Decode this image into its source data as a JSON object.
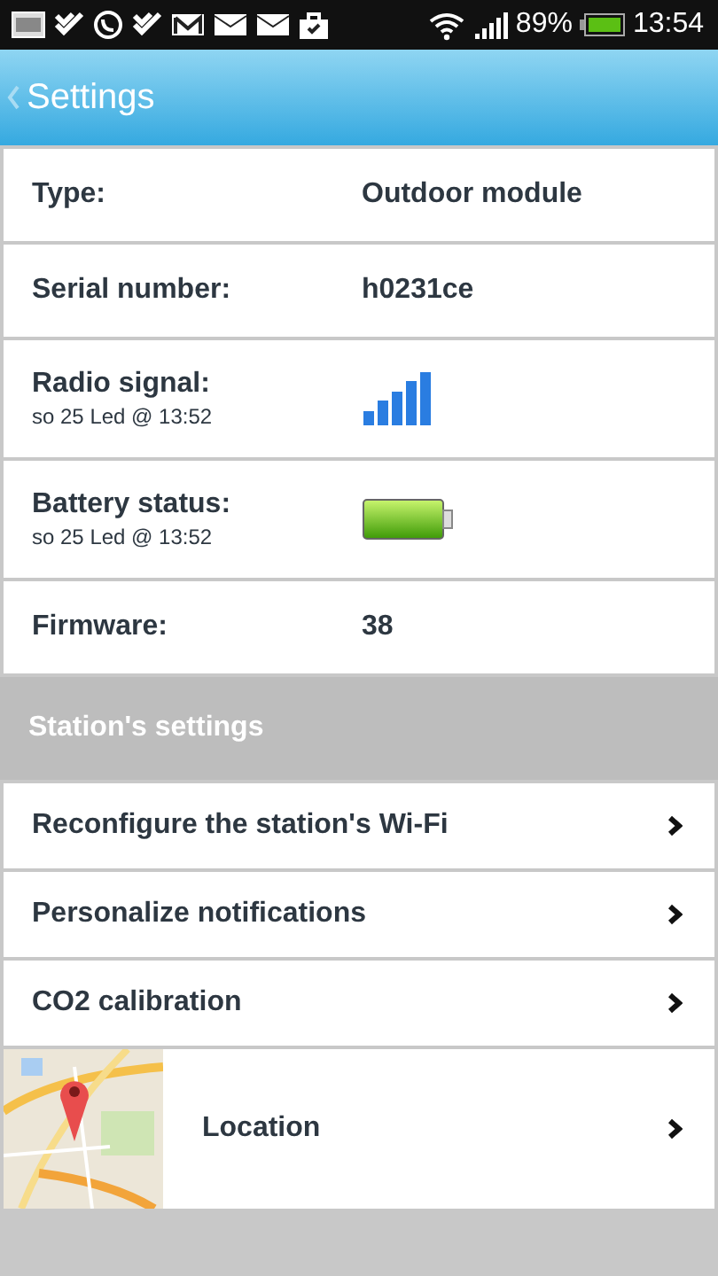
{
  "status_bar": {
    "battery": "89%",
    "time": "13:54"
  },
  "header": {
    "title": "Settings"
  },
  "info_rows": [
    {
      "kind": "text",
      "label": "Type:",
      "value": "Outdoor module"
    },
    {
      "kind": "text",
      "label": "Serial number:",
      "value": "h0231ce"
    },
    {
      "kind": "signal",
      "label": "Radio signal:",
      "subtitle": "so 25 Led @ 13:52"
    },
    {
      "kind": "battery",
      "label": "Battery status:",
      "subtitle": "so 25 Led @ 13:52"
    },
    {
      "kind": "text",
      "label": "Firmware:",
      "value": "38"
    }
  ],
  "section": {
    "title": "Station's settings"
  },
  "nav_items": [
    {
      "kind": "plain",
      "label": "Reconfigure the station's Wi-Fi"
    },
    {
      "kind": "plain",
      "label": "Personalize notifications"
    },
    {
      "kind": "plain",
      "label": "CO2 calibration"
    },
    {
      "kind": "map",
      "label": "Location"
    }
  ]
}
